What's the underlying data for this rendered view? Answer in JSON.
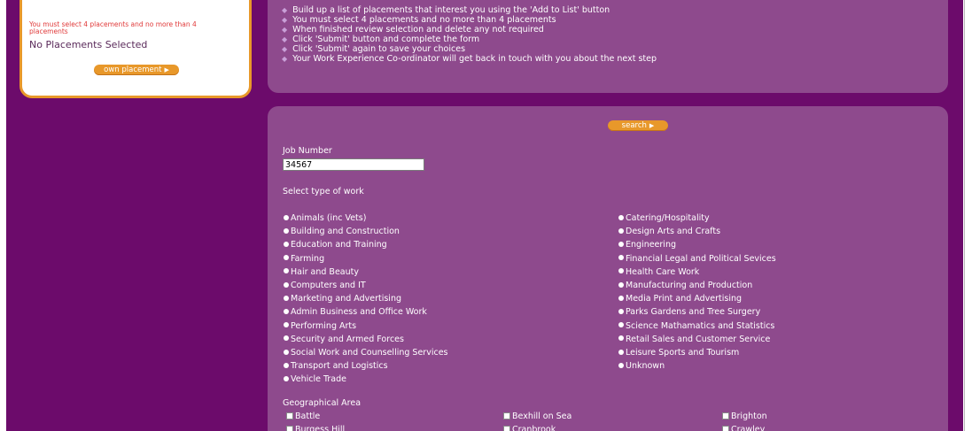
{
  "sidebar": {
    "warning": "You must select 4 placements and no more than 4 placements",
    "status": "No Placements Selected",
    "own_button": "own placement"
  },
  "instructions": [
    "Build up a list of placements that interest you using the 'Add to List' button",
    "You must select 4 placements and no more than 4 placements",
    "When finished review selection and delete any not required",
    "Click 'Submit' button and complete the form",
    "Click 'Submit' again to save your choices",
    "Your Work Experience Co-ordinator will get back in touch with you about the next step"
  ],
  "search": {
    "button": "search",
    "job_number_label": "Job Number",
    "job_number_value": "34567",
    "work_type_label": "Select type of work",
    "work_types_left": [
      "Animals (inc Vets)",
      "Building and Construction",
      "Education and Training",
      "Farming",
      "Hair and Beauty",
      "Computers and IT",
      "Marketing and Advertising",
      "Admin Business and Office Work",
      "Performing Arts",
      "Security and Armed Forces",
      "Social Work and Counselling Services",
      "Transport and Logistics",
      "Vehicle Trade"
    ],
    "work_types_right": [
      "Catering/Hospitality",
      "Design Arts and Crafts",
      "Engineering",
      "Financial Legal and Political Sevices",
      "Health Care Work",
      "Manufacturing and Production",
      "Media Print and Advertising",
      "Parks Gardens and Tree Surgery",
      "Science Mathamatics and Statistics",
      "Retail Sales and Customer Service",
      "Leisure Sports and Tourism",
      "Unknown"
    ],
    "geo_label": "Geographical Area",
    "geo_col1": [
      "Battle",
      "Burgess Hill"
    ],
    "geo_col2": [
      "Bexhill on Sea",
      "Cranbrook"
    ],
    "geo_col3": [
      "Brighton",
      "Crawley"
    ]
  },
  "colors": {
    "background": "#6c0b6b",
    "panel": "#8e4a8d",
    "accent": "#e8982a"
  }
}
